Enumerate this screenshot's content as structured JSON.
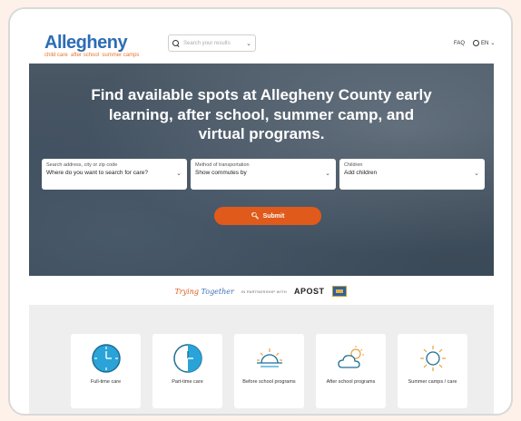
{
  "header": {
    "logo_main": "Allegheny",
    "logo_tagline": [
      "child care",
      "after school",
      "summer camps"
    ],
    "search_placeholder": "Search your results",
    "faq": "FAQ",
    "language": "EN"
  },
  "hero": {
    "title": "Find available spots at Allegheny County early learning, after school, summer camp, and virtual programs.",
    "fields": [
      {
        "label": "Search address, city or zip code",
        "value": "Where do you want to search for care?"
      },
      {
        "label": "Method of transportation",
        "value": "Show commutes by"
      },
      {
        "label": "Children",
        "value": "Add children"
      }
    ],
    "submit": "Submit"
  },
  "partners": {
    "trying_together_a": "Trying",
    "trying_together_b": "Together",
    "in_partnership": "IN PARTNERSHIP WITH",
    "apost": "APOST"
  },
  "services": [
    {
      "label": "Full-time care",
      "icon": "clock-full-icon"
    },
    {
      "label": "Part-time care",
      "icon": "clock-half-icon"
    },
    {
      "label": "Before school programs",
      "icon": "sunrise-icon"
    },
    {
      "label": "After school programs",
      "icon": "cloud-sun-icon"
    },
    {
      "label": "Summer camps / care",
      "icon": "sun-icon"
    }
  ],
  "colors": {
    "brand_blue": "#2c6db5",
    "brand_orange": "#e05a1b",
    "icon_teal": "#2aa3d8"
  }
}
